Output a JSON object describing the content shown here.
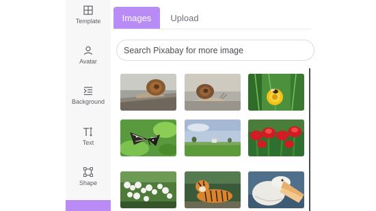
{
  "sidebar": {
    "items": [
      {
        "label": "Template",
        "icon": "template-grid-icon"
      },
      {
        "label": "Avatar",
        "icon": "person-icon"
      },
      {
        "label": "Background",
        "icon": "background-icon"
      },
      {
        "label": "Text",
        "icon": "text-icon"
      },
      {
        "label": "Shape",
        "icon": "shape-icon"
      }
    ]
  },
  "tabs": {
    "images": "Images",
    "upload": "Upload"
  },
  "search": {
    "placeholder": "Search Pixabay for more image"
  },
  "colors": {
    "accent": "#b88bf5"
  },
  "images": [
    {
      "subject": "snail-on-log"
    },
    {
      "subject": "snail-on-road"
    },
    {
      "subject": "bee-on-yellow-flower"
    },
    {
      "subject": "butterfly-on-leaves"
    },
    {
      "subject": "field-landscape"
    },
    {
      "subject": "red-tulips"
    },
    {
      "subject": "white-blossoms"
    },
    {
      "subject": "tiger"
    },
    {
      "subject": "pelican"
    }
  ]
}
